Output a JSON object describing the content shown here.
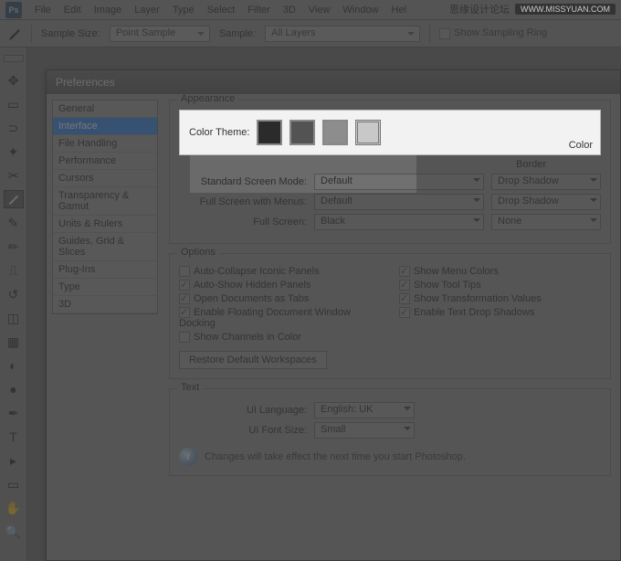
{
  "menubar": {
    "items": [
      "File",
      "Edit",
      "Image",
      "Layer",
      "Type",
      "Select",
      "Filter",
      "3D",
      "View",
      "Window",
      "Hel"
    ]
  },
  "watermark": {
    "text": "思缘设计论坛",
    "url": "WWW.MISSYUAN.COM"
  },
  "optionsbar": {
    "sample_size_label": "Sample Size:",
    "sample_size_value": "Point Sample",
    "sample_label": "Sample:",
    "sample_value": "All Layers",
    "show_ring_label": "Show Sampling Ring"
  },
  "prefs": {
    "title": "Preferences",
    "categories": [
      "General",
      "Interface",
      "File Handling",
      "Performance",
      "Cursors",
      "Transparency & Gamut",
      "Units & Rulers",
      "Guides, Grid & Slices",
      "Plug-Ins",
      "Type",
      "3D"
    ],
    "selected_index": 1,
    "appearance": {
      "legend": "Appearance",
      "color_theme_label": "Color Theme:",
      "sub_color": "Color",
      "sub_border": "Border",
      "rows": [
        {
          "label": "Standard Screen Mode:",
          "color": "Default",
          "border": "Drop Shadow"
        },
        {
          "label": "Full Screen with Menus:",
          "color": "Default",
          "border": "Drop Shadow"
        },
        {
          "label": "Full Screen:",
          "color": "Black",
          "border": "None"
        }
      ]
    },
    "options": {
      "legend": "Options",
      "left": [
        {
          "label": "Auto-Collapse Iconic Panels",
          "checked": false
        },
        {
          "label": "Auto-Show Hidden Panels",
          "checked": true
        },
        {
          "label": "Open Documents as Tabs",
          "checked": true
        },
        {
          "label": "Enable Floating Document Window Docking",
          "checked": true
        },
        {
          "label": "Show Channels in Color",
          "checked": false
        }
      ],
      "right": [
        {
          "label": "Show Menu Colors",
          "checked": true
        },
        {
          "label": "Show Tool Tips",
          "checked": true
        },
        {
          "label": "Show Transformation Values",
          "checked": true
        },
        {
          "label": "Enable Text Drop Shadows",
          "checked": true
        }
      ],
      "restore_btn": "Restore Default Workspaces"
    },
    "text": {
      "legend": "Text",
      "ui_language_label": "UI Language:",
      "ui_language_value": "English: UK",
      "ui_font_label": "UI Font Size:",
      "ui_font_value": "Small",
      "notice": "Changes will take effect the next time you start Photoshop."
    }
  }
}
